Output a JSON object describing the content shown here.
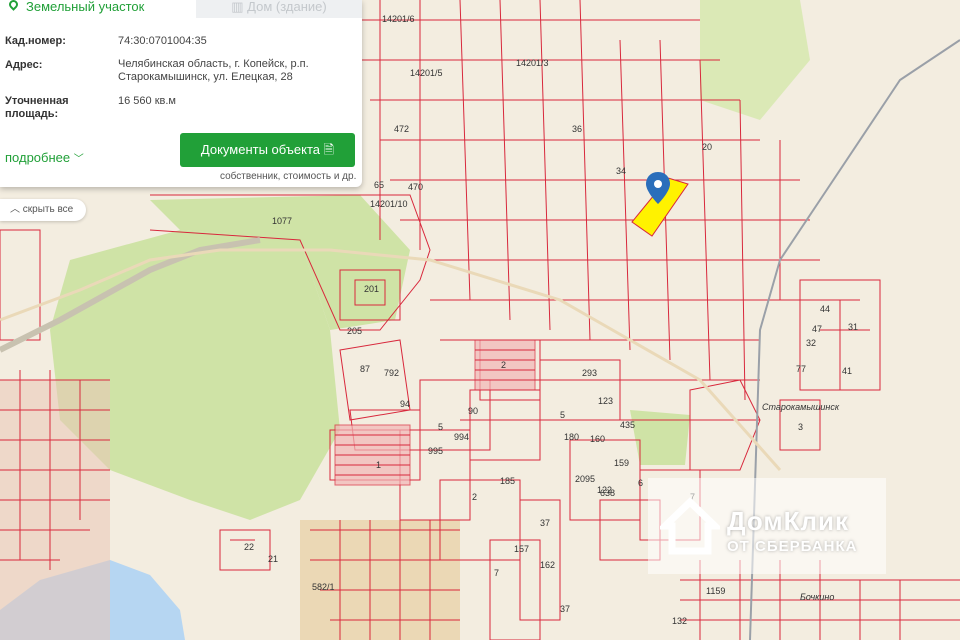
{
  "panel": {
    "tab_land": "Земельный участок",
    "tab_building": "Дом (здание)",
    "cadastral_label": "Кад.номер:",
    "cadastral_value": "74:30:0701004:35",
    "address_label": "Адрес:",
    "address_value": "Челябинская область, г. Копейск, р.п. Старокамышинск, ул. Елецкая, 28",
    "area_label": "Уточненная площадь:",
    "area_value": "16 560 кв.м",
    "more_label": "подробнее",
    "docs_button": "Документы объекта",
    "docs_note": "собственник, стоимость и др.",
    "hide_all": "скрыть все"
  },
  "map": {
    "parcel_labels": [
      "1077",
      "201",
      "205",
      "87",
      "792",
      "94",
      "90",
      "5",
      "995",
      "994",
      "1",
      "2",
      "293",
      "5",
      "123",
      "435",
      "160",
      "180",
      "159",
      "2095",
      "122",
      "7",
      "6",
      "185",
      "2",
      "37",
      "157",
      "162",
      "37",
      "7",
      "22",
      "21",
      "582/1",
      "1159",
      "132",
      "44",
      "47",
      "31",
      "32",
      "77",
      "41",
      "3",
      "36",
      "34",
      "20",
      "14201/6",
      "14201/5",
      "14201/3",
      "472",
      "470",
      "65",
      "14201/10",
      "638"
    ],
    "place_labels": [
      "Старокамышинск",
      "Бочкино"
    ],
    "colors": {
      "parcel": "#d8283c",
      "green": "#cfe3a6",
      "water": "#b6d6f2",
      "background": "#f3ede0",
      "selected": "#fff200",
      "accent": "#21a038"
    }
  },
  "logo": {
    "title": "ДомКлик",
    "subtitle": "ОТ СБЕРБАНКА"
  }
}
